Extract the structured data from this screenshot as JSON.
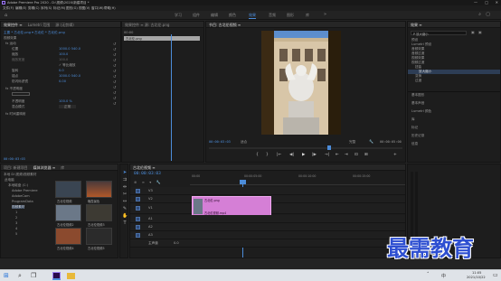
{
  "app": {
    "title": "Adobe Premiere Pro 2020 - D:\\视频\\2020\\新建项目 *",
    "menu": [
      "文件(F)",
      "编辑(E)",
      "剪辑(C)",
      "序列(S)",
      "标记(M)",
      "图形(G)",
      "视图(V)",
      "窗口(W)",
      "帮助(H)"
    ],
    "workspaces": [
      "学习",
      "组件",
      "编辑",
      "颜色",
      "效果",
      "音频",
      "图形",
      "库"
    ],
    "active_workspace": "效果",
    "win_controls": [
      "—",
      "□",
      "✕"
    ]
  },
  "effect_controls": {
    "tabs": [
      "效果控件 ≡",
      "Lumetri 范围",
      "源:(无剪辑)",
      "音频剪辑混合器:"
    ],
    "source": "主要 * 古北伦.png ▾ 古北伦 * 古北伦.png",
    "timecode_start": "00:00",
    "clip_label": "古北伦.png",
    "section_video": "视频效果",
    "rows": [
      {
        "label": "fx 运动",
        "value": ""
      },
      {
        "label": "位置",
        "value": "1000.0   540.0"
      },
      {
        "label": "缩放",
        "value": "100.0"
      },
      {
        "label": "缩放宽度",
        "value": "100.0"
      },
      {
        "label": "等比缩放",
        "value": "✓ 等比缩放"
      },
      {
        "label": "旋转",
        "value": "0.0"
      },
      {
        "label": "锚点",
        "value": "1000.0   540.0"
      },
      {
        "label": "防闪烁滤镜",
        "value": "0.00"
      },
      {
        "label": "fx 不透明度",
        "value": ""
      },
      {
        "label": "不透明度",
        "value": "100.0 %"
      },
      {
        "label": "混合模式",
        "value": "正常"
      },
      {
        "label": "fx 时间重映射",
        "value": ""
      }
    ],
    "timecode_bottom": "00:00:03:03"
  },
  "source_bin": {
    "tab": "效果控件 ≡  源: 古北伦.png",
    "item": "古北伦.png"
  },
  "program": {
    "tab": "节目: 古北伦视频 ≡",
    "timecode_left": "00:00:03:03",
    "fit": "适合",
    "quality": "完整",
    "timecode_right": "00:00:05:00"
  },
  "transport": [
    "{",
    "}",
    "|←",
    "◀|",
    "▶",
    "|▶",
    "→|",
    "⇤",
    "⇥",
    "⊡",
    "⊞",
    "+"
  ],
  "effects_panel": {
    "title": "效果 ≡",
    "search_placeholder": "P 放大缩小",
    "tree": [
      "预设",
      "Lumetri 预设",
      "音频效果",
      "音频过渡",
      "视频效果",
      "视频过渡",
      "扭曲",
      "放大缩小",
      "变换",
      "过渡"
    ],
    "sections": [
      "基本图形",
      "基本声音",
      "Lumetri 颜色",
      "库",
      "标记",
      "历史记录",
      "信息"
    ]
  },
  "project": {
    "tabs": [
      "项目: 新建项目",
      "媒体浏览器 ≡",
      "库",
      "信息"
    ],
    "path": "本地 D:\\视频\\视频素材",
    "folders": [
      "此电脑",
      "本地磁盘 (C:)",
      "Adobe Premiere",
      "AdobeCam",
      "ProgramData",
      "视频素材",
      "1",
      "2",
      "3",
      "4",
      "5"
    ],
    "thumbs": [
      {
        "label": "古北伦视频",
        "color": "#3a4552"
      },
      {
        "label": "晚霞景色",
        "color": "#b0582a"
      },
      {
        "label": "古北伦视频2",
        "color": "#6b7888"
      },
      {
        "label": "古北伦视频3",
        "color": "#3d3a33"
      },
      {
        "label": "古北伦视频4",
        "color": "#8b4a2e"
      },
      {
        "label": "古北伦视频5",
        "color": "#2b2b2b"
      }
    ]
  },
  "timeline": {
    "tab": "古北伦视频 ≡",
    "timecode": "00:00:03:03",
    "ruler": [
      "00:00",
      "00:00:05:00",
      "00:00:10:00",
      "00:00:15:00"
    ],
    "video_tracks": [
      "V3",
      "V2",
      "V1"
    ],
    "audio_tracks": [
      "A1",
      "A2",
      "A3"
    ],
    "master": "主声道",
    "master_value": "0.0",
    "clip_top": "古北伦.png",
    "clip_bottom": "古北伦视频.mp4",
    "clip_color": "#d57fd6"
  },
  "watermark": "最需教育",
  "taskbar": {
    "clock_time": "11:05",
    "clock_date": "2021/10/22",
    "lang": "中"
  }
}
